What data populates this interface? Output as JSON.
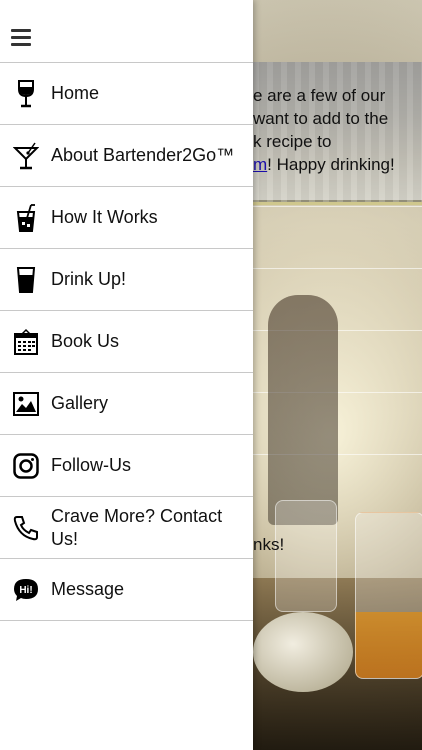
{
  "background": {
    "intro_lines": [
      "e are a few of our",
      "want to add to the",
      "k recipe to"
    ],
    "link_text": "m",
    "link_trailing": "! Happy drinking!",
    "caption_fragment": "nks!"
  },
  "drawer": {
    "menu_icon": "hamburger-icon",
    "items": [
      {
        "label": "Home",
        "icon": "wine-glass-icon"
      },
      {
        "label": "About Bartender2Go™",
        "icon": "martini-glass-icon"
      },
      {
        "label": "How It Works",
        "icon": "cocktail-straw-icon"
      },
      {
        "label": "Drink Up!",
        "icon": "pint-glass-icon"
      },
      {
        "label": "Book Us",
        "icon": "calendar-icon"
      },
      {
        "label": "Gallery",
        "icon": "image-icon"
      },
      {
        "label": "Follow-Us",
        "icon": "instagram-icon"
      },
      {
        "label": "Crave More? Contact Us!",
        "icon": "phone-icon"
      },
      {
        "label": "Message",
        "icon": "chat-bubble-icon"
      }
    ],
    "message_badge": "Hi!"
  }
}
